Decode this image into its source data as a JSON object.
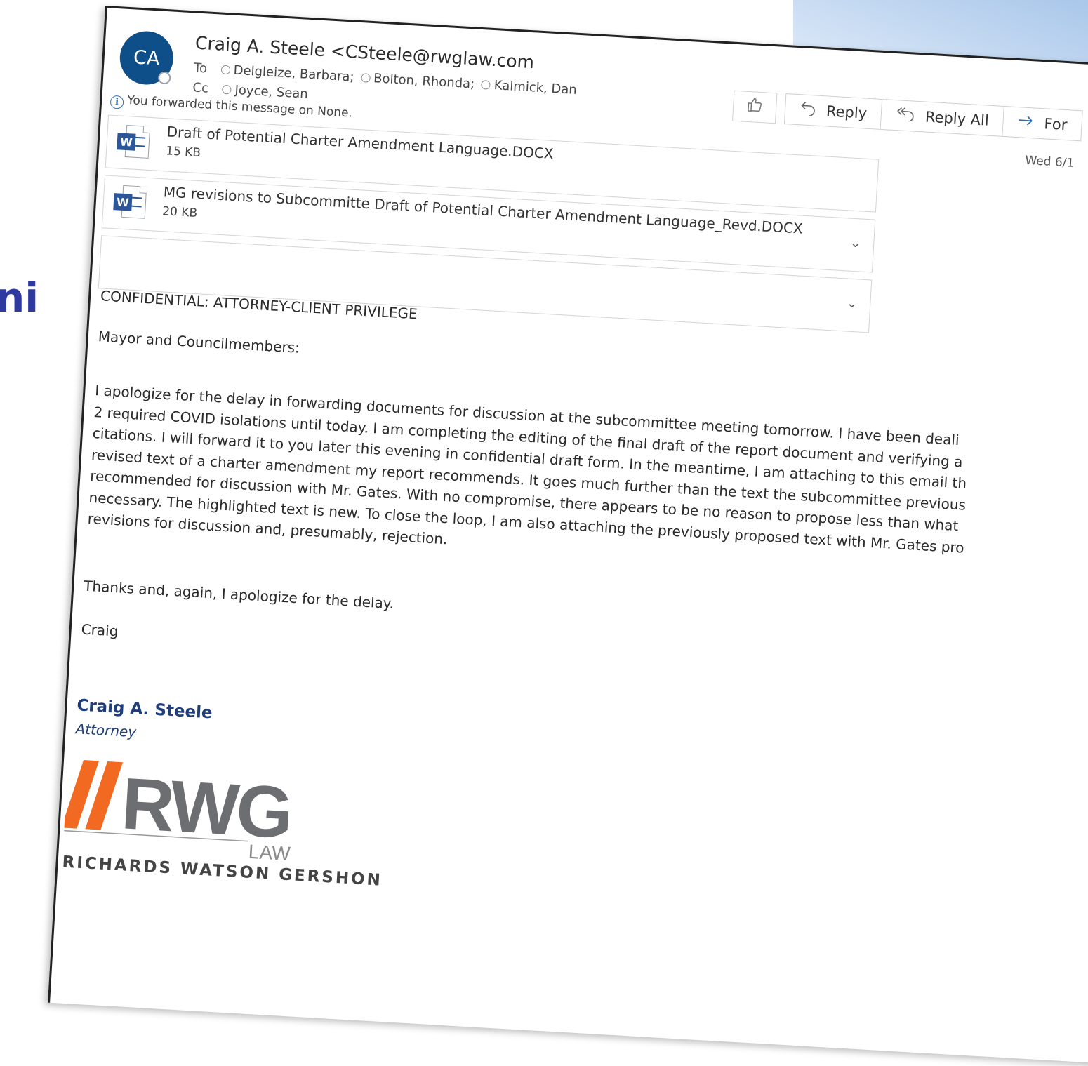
{
  "email": {
    "avatar_initials": "CA",
    "sender": "Craig A. Steele <CSteele@rwglaw.com",
    "to_label": "To",
    "to": [
      "Delgleize, Barbara;",
      "Bolton, Rhonda;",
      "Kalmick, Dan"
    ],
    "cc_label": "Cc",
    "cc": [
      "Joyce, Sean"
    ],
    "forward_note": "You forwarded this message on None.",
    "toolbar": {
      "reply": "Reply",
      "reply_all": "Reply All",
      "forward": "For"
    },
    "date": "Wed 6/1",
    "attachments": [
      {
        "name": "Draft of Potential Charter Amendment Language.DOCX",
        "size": "15 KB"
      },
      {
        "name": "MG revisions to Subcommitte Draft of Potential Charter Amendment Language_Revd.DOCX",
        "size": "20 KB"
      }
    ],
    "body": {
      "confidential": "CONFIDENTIAL: ATTORNEY-CLIENT PRIVILEGE",
      "greeting": "Mayor and Councilmembers:",
      "paragraph_lines": [
        "I apologize for the delay in forwarding documents for discussion at the subcommittee meeting tomorrow. I have been deali",
        "2 required COVID isolations until today. I am completing the editing of the final draft of the report document and verifying a",
        "citations. I will forward it to you later this evening in confidential draft form. In the meantime, I am attaching to this email th",
        "revised text of a charter amendment my report recommends. It goes much further than the text the subcommittee previous",
        "recommended for discussion with Mr. Gates. With no compromise, there appears to be no reason to propose less than what",
        "necessary. The highlighted text is new. To close the loop, I am also attaching the previously proposed text with Mr. Gates pro",
        "revisions for discussion and, presumably, rejection."
      ],
      "thanks": "Thanks and, again, I apologize for the delay.",
      "signoff": "Craig"
    },
    "signature": {
      "name": "Craig A. Steele",
      "title": "Attorney",
      "logo_text": "RWG",
      "logo_sub": "LAW",
      "firm": "RICHARDS WATSON GERSHON"
    }
  },
  "slide": {
    "title_fragment": "",
    "left_fragment": "ni"
  },
  "colors": {
    "avatar": "#0e4f8a",
    "word_blue": "#2b579a",
    "signature_blue": "#1f3e7a",
    "logo_orange": "#f26a21",
    "logo_gray": "#6d6e71",
    "slide_title": "#2f3aa0"
  },
  "icons": [
    "info-icon",
    "like-icon",
    "reply-icon",
    "reply-all-icon",
    "forward-icon",
    "word-doc-icon",
    "chevron-down-icon",
    "presence-icon"
  ]
}
